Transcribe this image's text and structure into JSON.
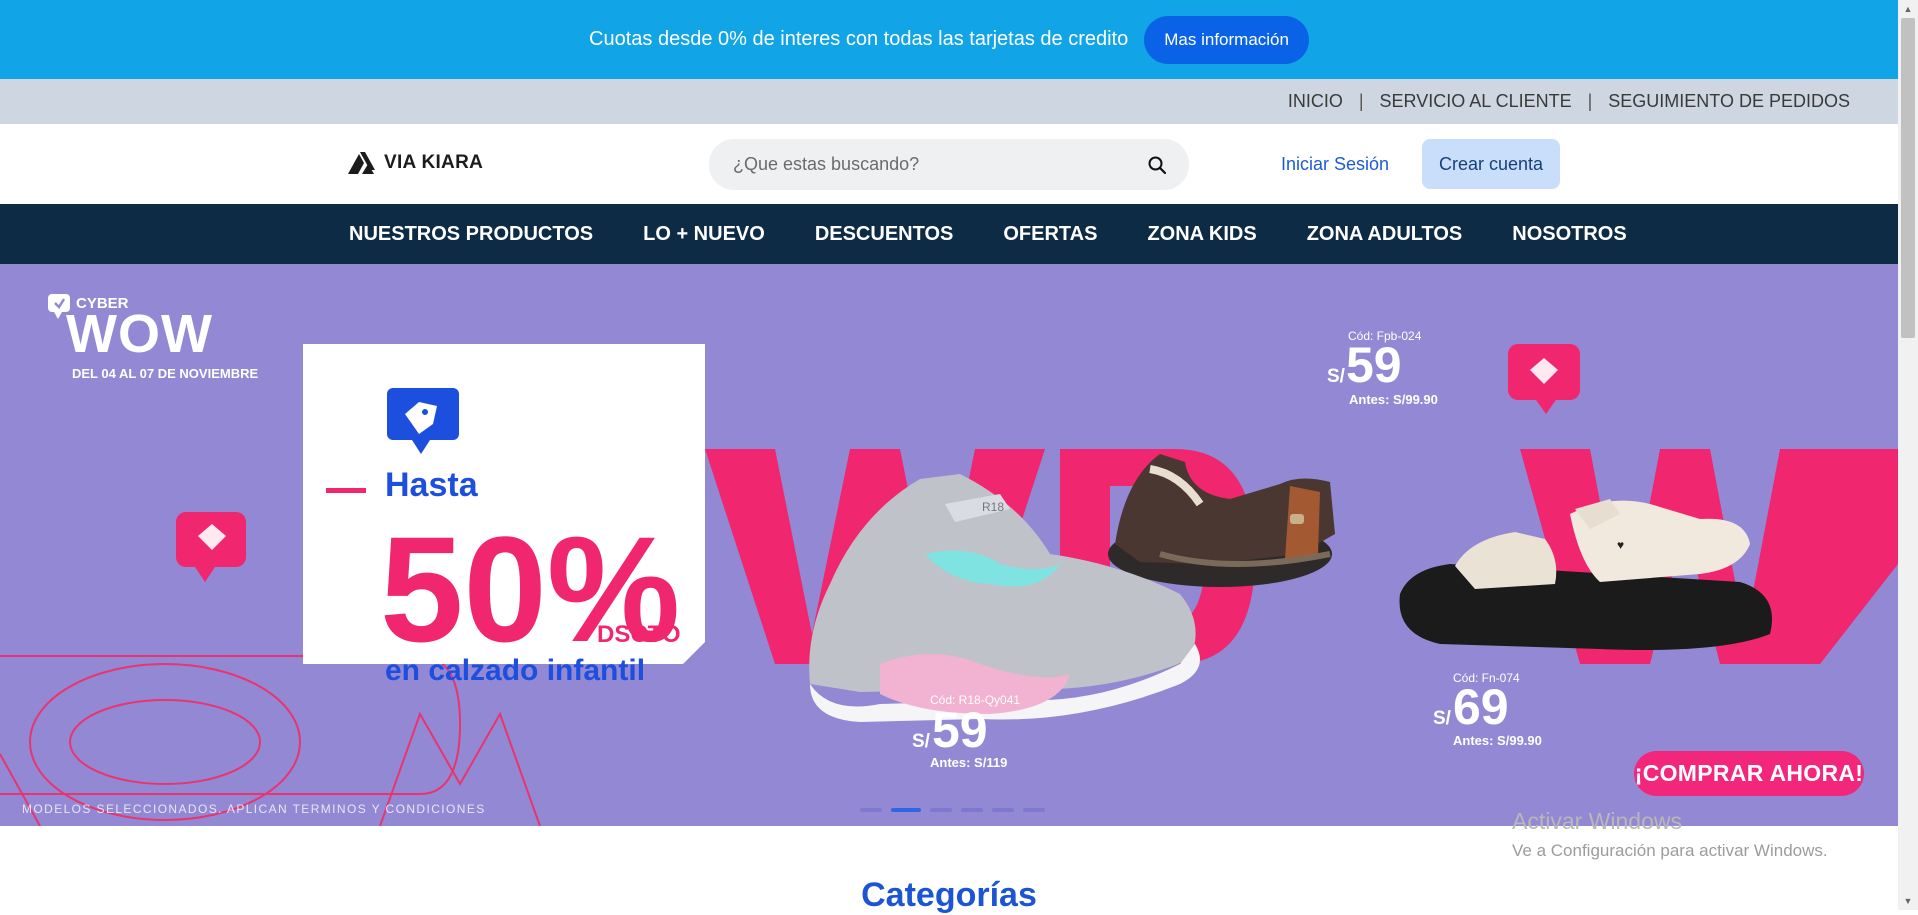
{
  "promo": {
    "text": "Cuotas desde 0% de interes con todas las tarjetas de credito",
    "button": "Mas información"
  },
  "toplinks": {
    "items": [
      "INICIO",
      "SERVICIO AL CLIENTE",
      "SEGUIMIENTO DE PEDIDOS"
    ],
    "separator": "|"
  },
  "header": {
    "logo": "VIA KIARA",
    "search_placeholder": "¿Que estas buscando?",
    "login": "Iniciar Sesión",
    "signup": "Crear cuenta"
  },
  "nav": {
    "items": [
      "NUESTROS PRODUCTOS",
      "LO + NUEVO",
      "DESCUENTOS",
      "OFERTAS",
      "ZONA KIDS",
      "ZONA ADULTOS",
      "NOSOTROS"
    ]
  },
  "hero": {
    "badge_top": "CYBER",
    "badge_title": "WOW",
    "dates": "DEL 04 AL 07 DE NOVIEMBRE",
    "promo_prefix": "Hasta",
    "discount": "50%",
    "discount_label": "DSCTO",
    "promo_subtitle": "en calzado infantil",
    "products": [
      {
        "code": "Cód: Fpb-024",
        "currency": "S/",
        "price": "59",
        "before": "Antes: S/99.90"
      },
      {
        "code": "Cód: R18-Qy041",
        "currency": "S/",
        "price": "59",
        "before": "Antes: S/119"
      },
      {
        "code": "Cód: Fn-074",
        "currency": "S/",
        "price": "69",
        "before": "Antes: S/99.90"
      }
    ],
    "cta": "¡COMPRAR AHORA!",
    "disclaimer": "MODELOS SELECCIONADOS. APLICAN TERMINOS Y CONDICIONES",
    "slides": 6,
    "active_slide": 2
  },
  "categories_title": "Categorías",
  "windows_watermark": {
    "line1": "Activar Windows",
    "line2": "Ve a Configuración para activar Windows."
  },
  "colors": {
    "promo_bg": "#11a5e8",
    "nav_bg": "#0d2b44",
    "hero_bg": "#9388d3",
    "accent_pink": "#f2267a",
    "accent_blue": "#1c55d4"
  }
}
